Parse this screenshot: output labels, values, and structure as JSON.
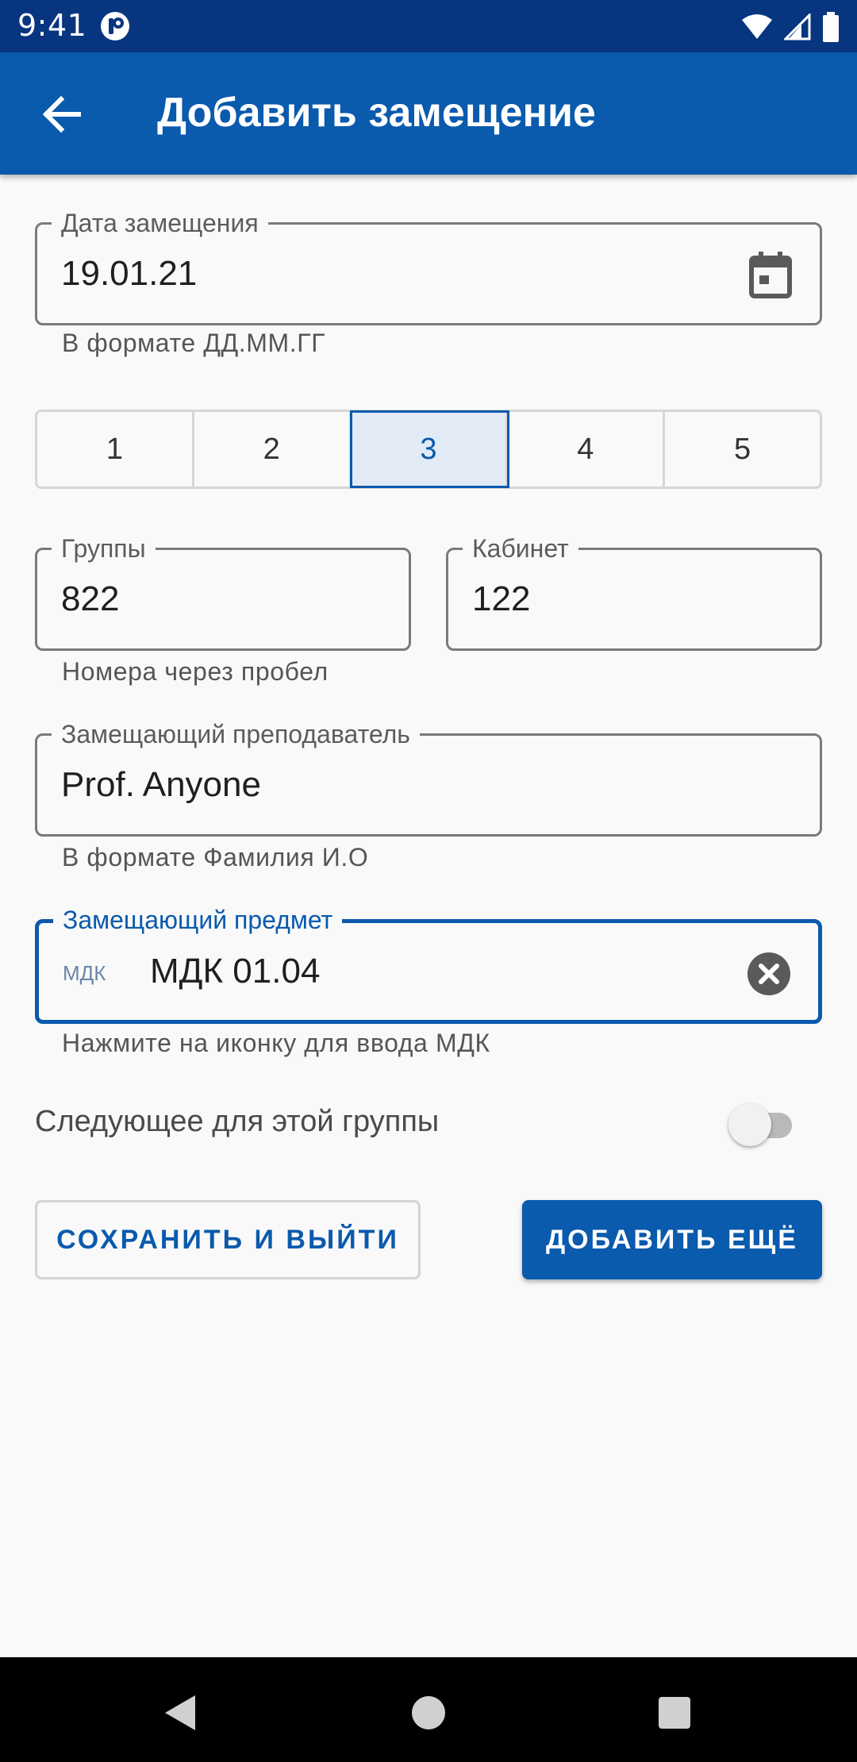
{
  "status_bar": {
    "time": "9:41"
  },
  "app_bar": {
    "title": "Добавить замещение",
    "back_icon": "arrow-back-icon"
  },
  "date_field": {
    "label": "Дата замещения",
    "value": "19.01.21",
    "helper": "В формате ДД.ММ.ГГ",
    "icon": "calendar-icon"
  },
  "lesson_segments": {
    "items": [
      "1",
      "2",
      "3",
      "4",
      "5"
    ],
    "selected": "3"
  },
  "groups_field": {
    "label": "Группы",
    "value": "822",
    "helper": "Номера через пробел"
  },
  "room_field": {
    "label": "Кабинет",
    "value": "122"
  },
  "teacher_field": {
    "label": "Замещающий преподаватель",
    "value": "Prof. Anyone",
    "helper": "В формате Фамилия И.О"
  },
  "subject_field": {
    "label": "Замещающий предмет",
    "prefix": "МДК",
    "value": "МДК 01.04",
    "helper": "Нажмите на иконку для ввода МДК",
    "clear_icon": "clear-circle-icon"
  },
  "next_toggle": {
    "label": "Следующее для этой группы",
    "checked": false
  },
  "actions": {
    "save_exit": "СОХРАНИТЬ И ВЫЙТИ",
    "add_more": "ДОБАВИТЬ ЕЩЁ"
  },
  "colors": {
    "status_bar": "#073580",
    "app_bar": "#0a5aad",
    "accent": "#0a5aad",
    "background": "#f9f9f9"
  }
}
